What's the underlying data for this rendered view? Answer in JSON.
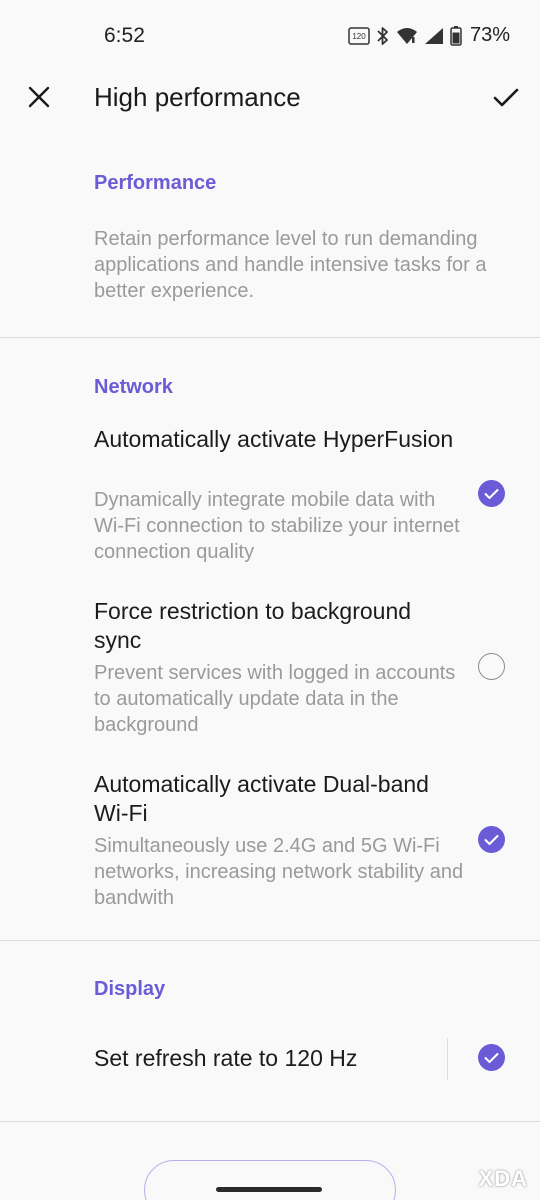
{
  "status_bar": {
    "time": "6:52",
    "battery": "73%",
    "refresh_badge": "120"
  },
  "app_bar": {
    "title": "High performance"
  },
  "sections": {
    "performance": {
      "header": "Performance",
      "description": "Retain performance level to run demanding applications and handle intensive tasks for a better experience."
    },
    "network": {
      "header": "Network",
      "items": [
        {
          "title": "Automatically activate HyperFusion",
          "subtitle": "Dynamically integrate mobile data with Wi-Fi connection to stabilize your internet connection quality",
          "checked": true
        },
        {
          "title": "Force restriction to background sync",
          "subtitle": "Prevent services with logged in accounts to automatically update data in the background",
          "checked": false
        },
        {
          "title": "Automatically activate Dual-band Wi-Fi",
          "subtitle": "Simultaneously use 2.4G and 5G Wi-Fi networks, increasing network stability and bandwith",
          "checked": true
        }
      ]
    },
    "display": {
      "header": "Display",
      "items": [
        {
          "title": "Set refresh rate to 120 Hz",
          "checked": true
        }
      ]
    }
  },
  "watermark": "XDA",
  "colors": {
    "accent": "#6b5bd6",
    "secondary_text": "#9a9a9a",
    "background": "#f9f9f9"
  }
}
